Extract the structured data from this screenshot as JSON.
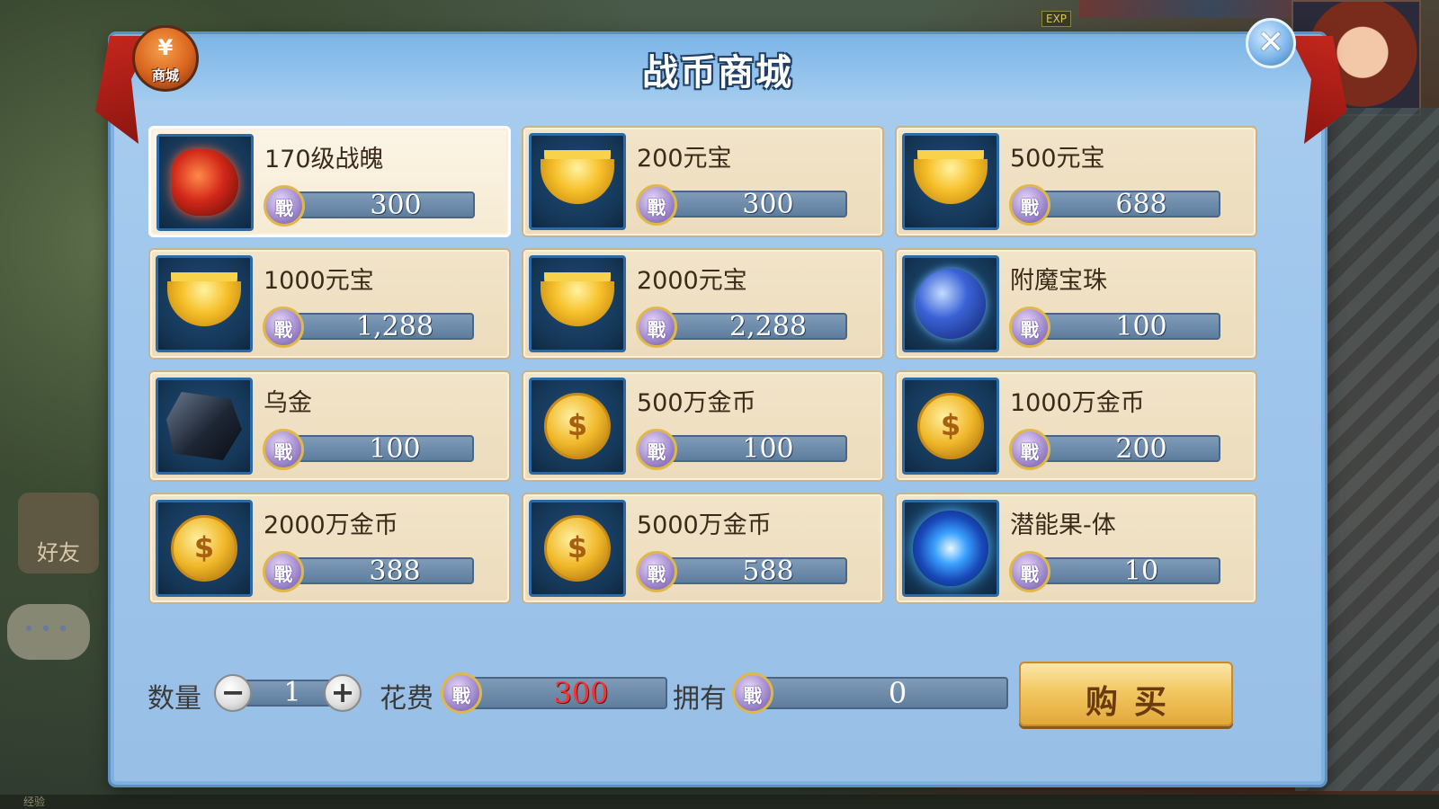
{
  "dialog": {
    "title": "战币商城",
    "shop_badge": {
      "glyph": "¥",
      "label": "商城"
    },
    "close_glyph": "✕"
  },
  "currency_glyph": "戰",
  "items": [
    {
      "name": "170级战魄",
      "price": "300",
      "icon": "soul-icon",
      "selected": true
    },
    {
      "name": "200元宝",
      "price": "300",
      "icon": "ingot-icon"
    },
    {
      "name": "500元宝",
      "price": "688",
      "icon": "ingot-icon"
    },
    {
      "name": "1000元宝",
      "price": "1,288",
      "icon": "ingot-icon"
    },
    {
      "name": "2000元宝",
      "price": "2,288",
      "icon": "ingot-icon"
    },
    {
      "name": "附魔宝珠",
      "price": "100",
      "icon": "orb-icon"
    },
    {
      "name": "乌金",
      "price": "100",
      "icon": "ore-icon"
    },
    {
      "name": "500万金币",
      "price": "100",
      "icon": "gold-coin-icon"
    },
    {
      "name": "1000万金币",
      "price": "200",
      "icon": "gold-coin-icon"
    },
    {
      "name": "2000万金币",
      "price": "388",
      "icon": "gold-coin-icon"
    },
    {
      "name": "5000万金币",
      "price": "588",
      "icon": "gold-coin-icon"
    },
    {
      "name": "潜能果-体",
      "price": "10",
      "icon": "potential-fruit-icon"
    }
  ],
  "purchase": {
    "quantity_label": "数量",
    "quantity": "1",
    "minus_glyph": "−",
    "plus_glyph": "+",
    "cost_label": "花费",
    "cost": "300",
    "own_label": "拥有",
    "owned": "0",
    "buy_label": "购买"
  },
  "background": {
    "friend_label": "好友",
    "chat_dots": "•••",
    "exp_label": "EXP",
    "bottom_label": "经验"
  },
  "colors": {
    "cost_value": "#ff3030",
    "buy_button": "#f2c862",
    "panel": "#a9cdee"
  }
}
